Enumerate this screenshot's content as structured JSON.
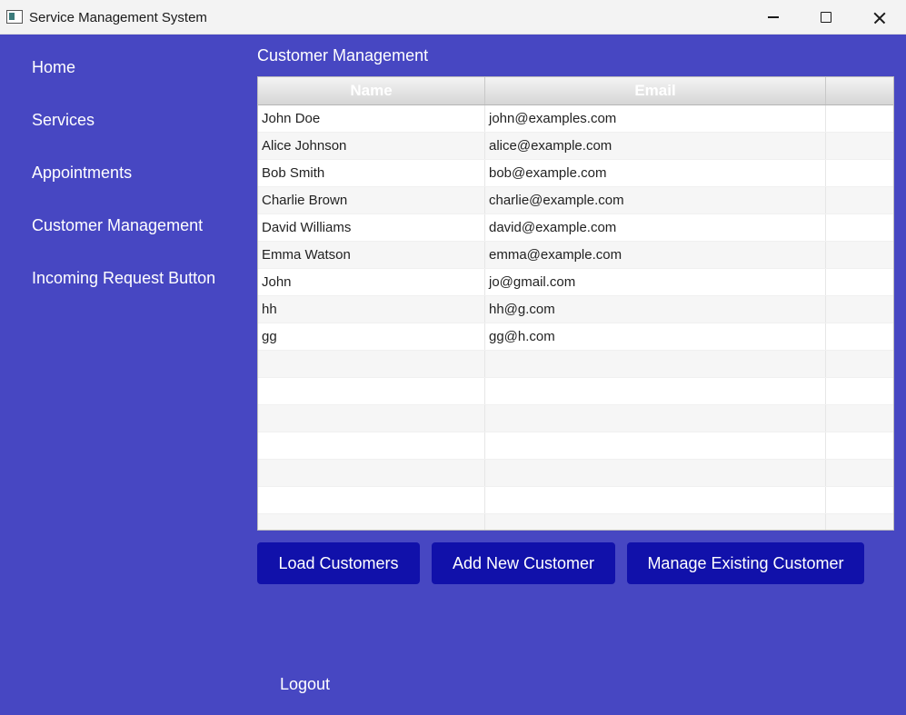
{
  "window": {
    "title": "Service Management System"
  },
  "nav": {
    "items": [
      "Home",
      "Services",
      "Appointments",
      "Customer Management",
      "Incoming Request Button"
    ]
  },
  "main": {
    "title": "Customer Management",
    "table": {
      "headers": [
        "Name",
        "Email",
        ""
      ],
      "rows": [
        [
          "John Doe",
          "john@examples.com",
          ""
        ],
        [
          "Alice Johnson",
          "alice@example.com",
          ""
        ],
        [
          "Bob Smith",
          "bob@example.com",
          ""
        ],
        [
          "Charlie Brown",
          "charlie@example.com",
          ""
        ],
        [
          "David Williams",
          "david@example.com",
          ""
        ],
        [
          "Emma Watson",
          "emma@example.com",
          ""
        ],
        [
          "John",
          "jo@gmail.com",
          ""
        ],
        [
          "hh",
          "hh@g.com",
          ""
        ],
        [
          "gg",
          "gg@h.com",
          ""
        ],
        [
          "",
          "",
          ""
        ],
        [
          "",
          "",
          ""
        ],
        [
          "",
          "",
          ""
        ],
        [
          "",
          "",
          ""
        ],
        [
          "",
          "",
          ""
        ],
        [
          "",
          "",
          ""
        ],
        [
          "",
          "",
          ""
        ]
      ]
    },
    "buttons": {
      "load": "Load Customers",
      "add": "Add New Customer",
      "manage": "Manage Existing Customer"
    },
    "logout": "Logout"
  },
  "colors": {
    "background": "#4747c2",
    "button": "#1111aa"
  }
}
